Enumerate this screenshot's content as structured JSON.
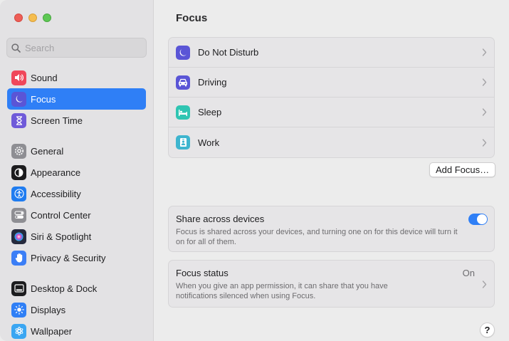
{
  "window": {
    "traffic_lights": {
      "close": "#ee5e57",
      "minimize": "#f5bd4f",
      "zoom": "#5ec854"
    }
  },
  "sidebar": {
    "search_placeholder": "Search",
    "groups": [
      [
        {
          "label": "Sound",
          "icon": "speaker-icon",
          "color": "#f0475a"
        },
        {
          "label": "Focus",
          "icon": "moon-icon",
          "color": "#5a55d6",
          "active": true
        },
        {
          "label": "Screen Time",
          "icon": "hourglass-icon",
          "color": "#6f5ad9"
        }
      ],
      [
        {
          "label": "General",
          "icon": "gear-icon",
          "color": "#8e8e93"
        },
        {
          "label": "Appearance",
          "icon": "appearance-icon",
          "color": "#1c1c1e"
        },
        {
          "label": "Accessibility",
          "icon": "accessibility-icon",
          "color": "#1f7cf0"
        },
        {
          "label": "Control Center",
          "icon": "control-center-icon",
          "color": "#8e8e93"
        },
        {
          "label": "Siri & Spotlight",
          "icon": "siri-icon",
          "color": "#262a3d"
        },
        {
          "label": "Privacy & Security",
          "icon": "hand-icon",
          "color": "#3b7ef6"
        }
      ],
      [
        {
          "label": "Desktop & Dock",
          "icon": "dock-icon",
          "color": "#1c1c1e"
        },
        {
          "label": "Displays",
          "icon": "sun-icon",
          "color": "#2f7ff6"
        },
        {
          "label": "Wallpaper",
          "icon": "wallpaper-icon",
          "color": "#3aa6f2"
        }
      ]
    ]
  },
  "main": {
    "title": "Focus",
    "focus_modes": [
      {
        "label": "Do Not Disturb",
        "icon": "moon-icon",
        "color": "#5a55d6"
      },
      {
        "label": "Driving",
        "icon": "car-icon",
        "color": "#5a55d6"
      },
      {
        "label": "Sleep",
        "icon": "bed-icon",
        "color": "#2fc5b2"
      },
      {
        "label": "Work",
        "icon": "badge-icon",
        "color": "#3eb5cf"
      }
    ],
    "add_focus_label": "Add Focus…",
    "share": {
      "title": "Share across devices",
      "description": "Focus is shared across your devices, and turning one on for this device will turn it on for all of them.",
      "enabled": true
    },
    "status": {
      "title": "Focus status",
      "value": "On",
      "description": "When you give an app permission, it can share that you have notifications silenced when using Focus."
    },
    "help_label": "?"
  }
}
